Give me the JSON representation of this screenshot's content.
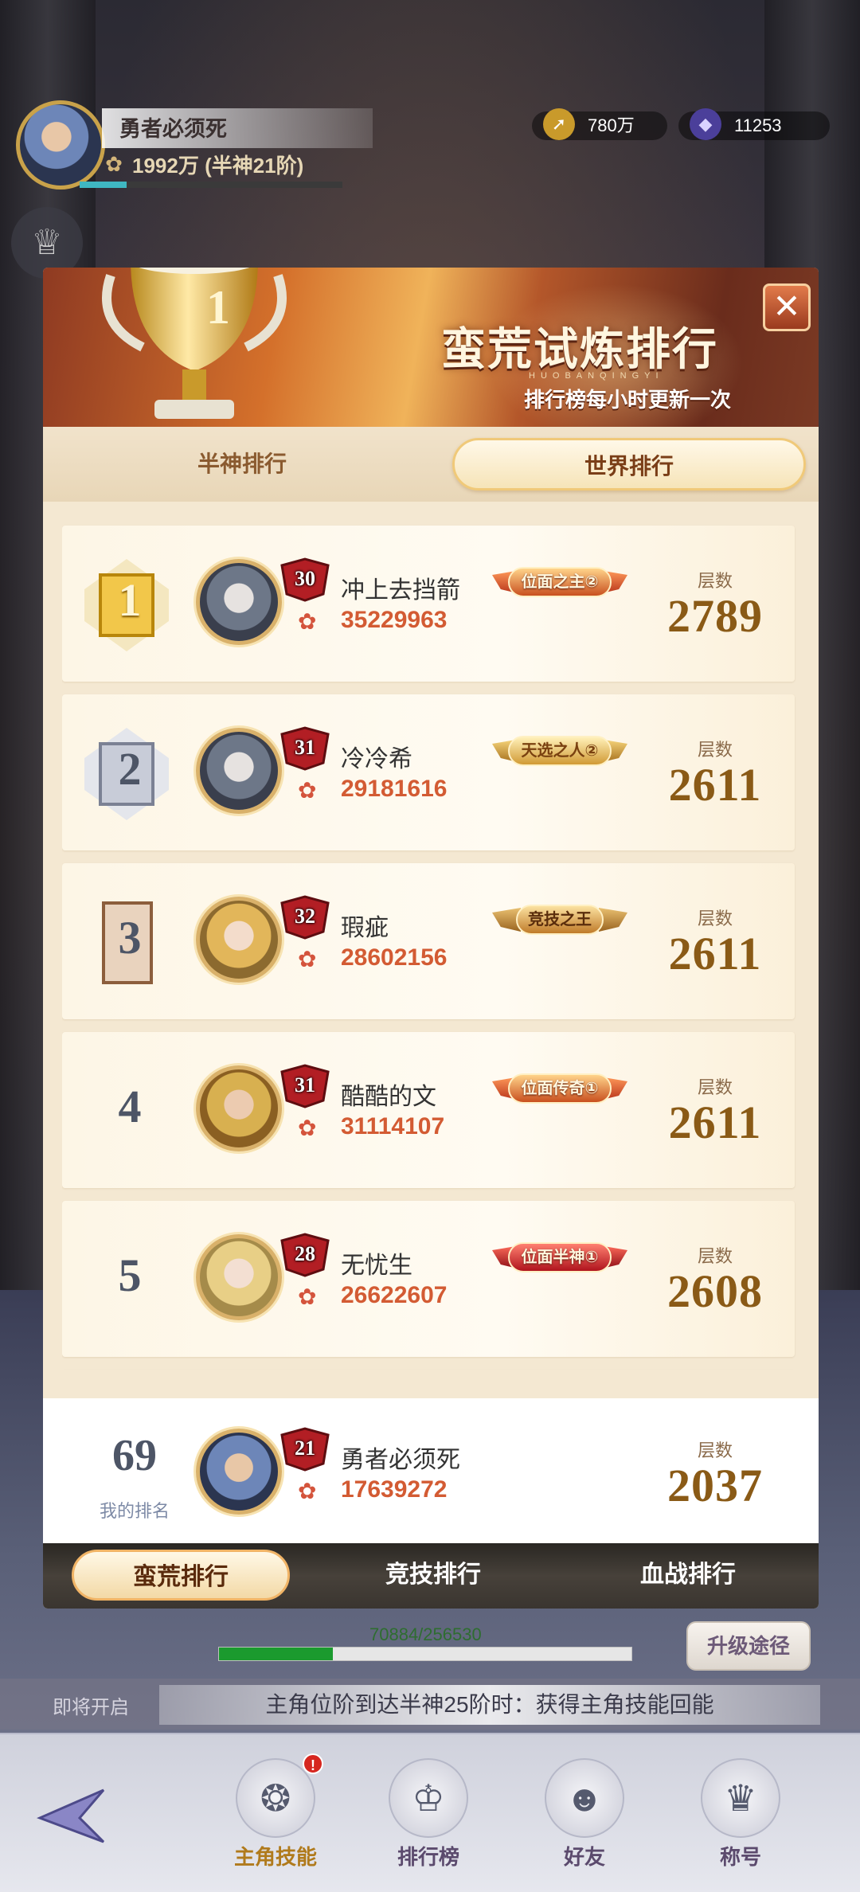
{
  "hud": {
    "player_name": "勇者必须死",
    "power": "1992万 (半神21阶)",
    "gold": "780万",
    "gems": "11253",
    "xp_fraction": 0.18
  },
  "modal": {
    "title": "蛮荒试炼排行",
    "subtitle_en": "HUOBANQINGYI",
    "subtitle": "排行榜每小时更新一次",
    "close_icon": "close-icon",
    "tabs": [
      {
        "label": "半神排行",
        "active": false
      },
      {
        "label": "世界排行",
        "active": true
      }
    ]
  },
  "ranking": [
    {
      "rank": "1",
      "level": "30",
      "name": "冲上去挡箭",
      "power": "35229963",
      "title": "位面之主",
      "title_level": "②",
      "floor_label": "层数",
      "floor": "2789"
    },
    {
      "rank": "2",
      "level": "31",
      "name": "冷冷希",
      "power": "29181616",
      "title": "天选之人",
      "title_level": "②",
      "floor_label": "层数",
      "floor": "2611"
    },
    {
      "rank": "3",
      "level": "32",
      "name": "瑕疵",
      "power": "28602156",
      "title": "竞技之王",
      "title_level": "",
      "floor_label": "层数",
      "floor": "2611"
    },
    {
      "rank": "4",
      "level": "31",
      "name": "酷酷的文",
      "power": "31114107",
      "title": "位面传奇",
      "title_level": "①",
      "floor_label": "层数",
      "floor": "2611"
    },
    {
      "rank": "5",
      "level": "28",
      "name": "无忧生",
      "power": "26622607",
      "title": "位面半神",
      "title_level": "①",
      "floor_label": "层数",
      "floor": "2608"
    }
  ],
  "my_rank": {
    "rank": "69",
    "label": "我的排名",
    "level": "21",
    "name": "勇者必须死",
    "power": "17639272",
    "floor_label": "层数",
    "floor": "2037"
  },
  "bottom_tabs": [
    {
      "label": "蛮荒排行",
      "active": true
    },
    {
      "label": "竞技排行",
      "active": false
    },
    {
      "label": "血战排行",
      "active": false
    }
  ],
  "progress": {
    "text": "70884/256530",
    "value": 70884,
    "max": 256530,
    "upgrade_label": "升级途径"
  },
  "notice": {
    "left": "即将开启",
    "text": "主角位阶到达半神25阶时：获得主角技能回能"
  },
  "nav": [
    {
      "label": "主角技能",
      "icon": "skill-icon",
      "badge": "!"
    },
    {
      "label": "排行榜",
      "icon": "trophy-icon",
      "badge": ""
    },
    {
      "label": "好友",
      "icon": "friend-icon",
      "badge": ""
    },
    {
      "label": "称号",
      "icon": "crown-icon",
      "badge": ""
    }
  ],
  "colors": {
    "accent_orange": "#d35b33",
    "gold_text": "#8a5a16",
    "progress_green": "#1b9a2e"
  }
}
